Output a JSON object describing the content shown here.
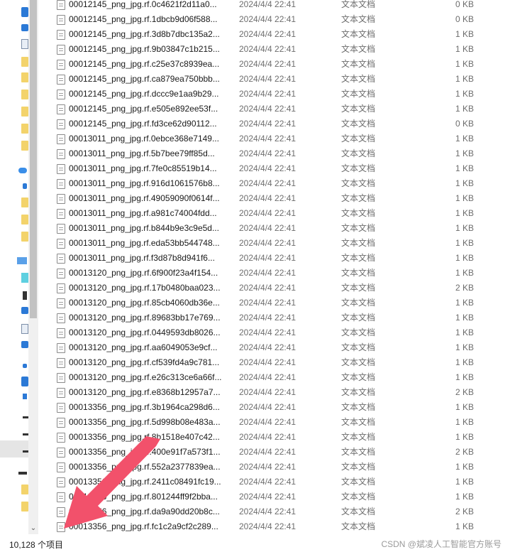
{
  "files": [
    {
      "name": "00012145_png_jpg.rf.0c4621f2d11a0...",
      "date": "2024/4/4 22:41",
      "type": "文本文档",
      "size": "0 KB"
    },
    {
      "name": "00012145_png_jpg.rf.1dbcb9d06f588...",
      "date": "2024/4/4 22:41",
      "type": "文本文档",
      "size": "0 KB"
    },
    {
      "name": "00012145_png_jpg.rf.3d8b7dbc135a2...",
      "date": "2024/4/4 22:41",
      "type": "文本文档",
      "size": "1 KB"
    },
    {
      "name": "00012145_png_jpg.rf.9b03847c1b215...",
      "date": "2024/4/4 22:41",
      "type": "文本文档",
      "size": "1 KB"
    },
    {
      "name": "00012145_png_jpg.rf.c25e37c8939ea...",
      "date": "2024/4/4 22:41",
      "type": "文本文档",
      "size": "1 KB"
    },
    {
      "name": "00012145_png_jpg.rf.ca879ea750bbb...",
      "date": "2024/4/4 22:41",
      "type": "文本文档",
      "size": "1 KB"
    },
    {
      "name": "00012145_png_jpg.rf.dccc9e1aa9b29...",
      "date": "2024/4/4 22:41",
      "type": "文本文档",
      "size": "1 KB"
    },
    {
      "name": "00012145_png_jpg.rf.e505e892ee53f...",
      "date": "2024/4/4 22:41",
      "type": "文本文档",
      "size": "1 KB"
    },
    {
      "name": "00012145_png_jpg.rf.fd3ce62d90112...",
      "date": "2024/4/4 22:41",
      "type": "文本文档",
      "size": "0 KB"
    },
    {
      "name": "00013011_png_jpg.rf.0ebce368e7149...",
      "date": "2024/4/4 22:41",
      "type": "文本文档",
      "size": "1 KB"
    },
    {
      "name": "00013011_png_jpg.rf.5b7bee79ff85d...",
      "date": "2024/4/4 22:41",
      "type": "文本文档",
      "size": "1 KB"
    },
    {
      "name": "00013011_png_jpg.rf.7fe0c85519b14...",
      "date": "2024/4/4 22:41",
      "type": "文本文档",
      "size": "1 KB"
    },
    {
      "name": "00013011_png_jpg.rf.916d1061576b8...",
      "date": "2024/4/4 22:41",
      "type": "文本文档",
      "size": "1 KB"
    },
    {
      "name": "00013011_png_jpg.rf.49059090f0614f...",
      "date": "2024/4/4 22:41",
      "type": "文本文档",
      "size": "1 KB"
    },
    {
      "name": "00013011_png_jpg.rf.a981c74004fdd...",
      "date": "2024/4/4 22:41",
      "type": "文本文档",
      "size": "1 KB"
    },
    {
      "name": "00013011_png_jpg.rf.b844b9e3c9e5d...",
      "date": "2024/4/4 22:41",
      "type": "文本文档",
      "size": "1 KB"
    },
    {
      "name": "00013011_png_jpg.rf.eda53bb544748...",
      "date": "2024/4/4 22:41",
      "type": "文本文档",
      "size": "1 KB"
    },
    {
      "name": "00013011_png_jpg.rf.f3d87b8d941f6...",
      "date": "2024/4/4 22:41",
      "type": "文本文档",
      "size": "1 KB"
    },
    {
      "name": "00013120_png_jpg.rf.6f900f23a4f154...",
      "date": "2024/4/4 22:41",
      "type": "文本文档",
      "size": "1 KB"
    },
    {
      "name": "00013120_png_jpg.rf.17b0480baa023...",
      "date": "2024/4/4 22:41",
      "type": "文本文档",
      "size": "2 KB"
    },
    {
      "name": "00013120_png_jpg.rf.85cb4060db36e...",
      "date": "2024/4/4 22:41",
      "type": "文本文档",
      "size": "1 KB"
    },
    {
      "name": "00013120_png_jpg.rf.89683bb17e769...",
      "date": "2024/4/4 22:41",
      "type": "文本文档",
      "size": "1 KB"
    },
    {
      "name": "00013120_png_jpg.rf.0449593db8026...",
      "date": "2024/4/4 22:41",
      "type": "文本文档",
      "size": "1 KB"
    },
    {
      "name": "00013120_png_jpg.rf.aa6049053e9cf...",
      "date": "2024/4/4 22:41",
      "type": "文本文档",
      "size": "1 KB"
    },
    {
      "name": "00013120_png_jpg.rf.cf539fd4a9c781...",
      "date": "2024/4/4 22:41",
      "type": "文本文档",
      "size": "1 KB"
    },
    {
      "name": "00013120_png_jpg.rf.e26c313ce6a66f...",
      "date": "2024/4/4 22:41",
      "type": "文本文档",
      "size": "1 KB"
    },
    {
      "name": "00013120_png_jpg.rf.e8368b12957a7...",
      "date": "2024/4/4 22:41",
      "type": "文本文档",
      "size": "2 KB"
    },
    {
      "name": "00013356_png_jpg.rf.3b1964ca298d6...",
      "date": "2024/4/4 22:41",
      "type": "文本文档",
      "size": "1 KB"
    },
    {
      "name": "00013356_png_jpg.rf.5d998b08e483a...",
      "date": "2024/4/4 22:41",
      "type": "文本文档",
      "size": "1 KB"
    },
    {
      "name": "00013356_png_jpg.rf.8b1518e407c42...",
      "date": "2024/4/4 22:41",
      "type": "文本文档",
      "size": "1 KB"
    },
    {
      "name": "00013356_png_jpg.rf.400e91f7a573f1...",
      "date": "2024/4/4 22:41",
      "type": "文本文档",
      "size": "2 KB"
    },
    {
      "name": "00013356_png_jpg.rf.552a2377839ea...",
      "date": "2024/4/4 22:41",
      "type": "文本文档",
      "size": "1 KB"
    },
    {
      "name": "00013356_png_jpg.rf.2411c08491fc19...",
      "date": "2024/4/4 22:41",
      "type": "文本文档",
      "size": "1 KB"
    },
    {
      "name": "00013356_png_jpg.rf.801244ff9f2bba...",
      "date": "2024/4/4 22:41",
      "type": "文本文档",
      "size": "1 KB"
    },
    {
      "name": "00013356_png_jpg.rf.da9a90dd20b8c...",
      "date": "2024/4/4 22:41",
      "type": "文本文档",
      "size": "2 KB"
    },
    {
      "name": "00013356_png_jpg.rf.fc1c2a9cf2c289...",
      "date": "2024/4/4 22:41",
      "type": "文本文档",
      "size": "1 KB"
    }
  ],
  "status": {
    "item_count": "10,128 个项目",
    "watermark": "CSDN @斌凌人工智能官方账号"
  },
  "nav": {
    "icons": [
      "blue-folder-icon",
      "download-icon",
      "document-icon",
      "folder-icon",
      "folder-icon",
      "folder-icon",
      "folder-icon",
      "folder-icon",
      "folder-icon",
      "folder-icon",
      "cloud-icon",
      "blue-item-icon",
      "folder-icon",
      "folder-icon",
      "folder-icon",
      "folder-icon",
      "this-pc-icon",
      "3d-objects-icon",
      "video-icon",
      "image-icon",
      "document-icon",
      "download-icon",
      "music-icon",
      "desktop-icon",
      "drive-icon",
      "drive-icon",
      "drive-icon",
      "drive-icon",
      "network-drive-icon",
      "folder-icon",
      "folder-icon"
    ],
    "down_arrow": "⌄"
  },
  "colors": {
    "annotation_arrow": "#f2516b",
    "nav_scroll_thumb": "#c2c2c2"
  }
}
